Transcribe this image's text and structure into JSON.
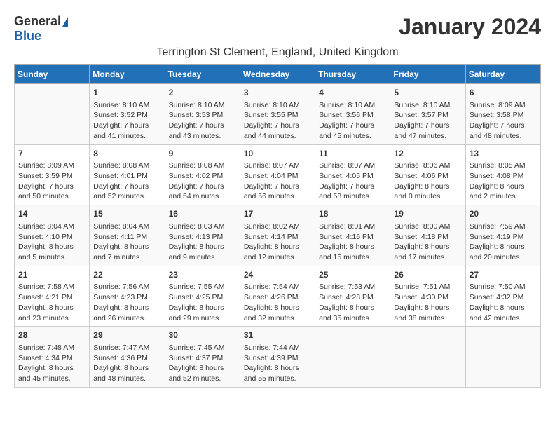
{
  "logo": {
    "general": "General",
    "blue": "Blue"
  },
  "title": "January 2024",
  "location": "Terrington St Clement, England, United Kingdom",
  "headers": [
    "Sunday",
    "Monday",
    "Tuesday",
    "Wednesday",
    "Thursday",
    "Friday",
    "Saturday"
  ],
  "weeks": [
    [
      {
        "day": "",
        "info": ""
      },
      {
        "day": "1",
        "info": "Sunrise: 8:10 AM\nSunset: 3:52 PM\nDaylight: 7 hours and 41 minutes."
      },
      {
        "day": "2",
        "info": "Sunrise: 8:10 AM\nSunset: 3:53 PM\nDaylight: 7 hours and 43 minutes."
      },
      {
        "day": "3",
        "info": "Sunrise: 8:10 AM\nSunset: 3:55 PM\nDaylight: 7 hours and 44 minutes."
      },
      {
        "day": "4",
        "info": "Sunrise: 8:10 AM\nSunset: 3:56 PM\nDaylight: 7 hours and 45 minutes."
      },
      {
        "day": "5",
        "info": "Sunrise: 8:10 AM\nSunset: 3:57 PM\nDaylight: 7 hours and 47 minutes."
      },
      {
        "day": "6",
        "info": "Sunrise: 8:09 AM\nSunset: 3:58 PM\nDaylight: 7 hours and 48 minutes."
      }
    ],
    [
      {
        "day": "7",
        "info": "Sunrise: 8:09 AM\nSunset: 3:59 PM\nDaylight: 7 hours and 50 minutes."
      },
      {
        "day": "8",
        "info": "Sunrise: 8:08 AM\nSunset: 4:01 PM\nDaylight: 7 hours and 52 minutes."
      },
      {
        "day": "9",
        "info": "Sunrise: 8:08 AM\nSunset: 4:02 PM\nDaylight: 7 hours and 54 minutes."
      },
      {
        "day": "10",
        "info": "Sunrise: 8:07 AM\nSunset: 4:04 PM\nDaylight: 7 hours and 56 minutes."
      },
      {
        "day": "11",
        "info": "Sunrise: 8:07 AM\nSunset: 4:05 PM\nDaylight: 7 hours and 58 minutes."
      },
      {
        "day": "12",
        "info": "Sunrise: 8:06 AM\nSunset: 4:06 PM\nDaylight: 8 hours and 0 minutes."
      },
      {
        "day": "13",
        "info": "Sunrise: 8:05 AM\nSunset: 4:08 PM\nDaylight: 8 hours and 2 minutes."
      }
    ],
    [
      {
        "day": "14",
        "info": "Sunrise: 8:04 AM\nSunset: 4:10 PM\nDaylight: 8 hours and 5 minutes."
      },
      {
        "day": "15",
        "info": "Sunrise: 8:04 AM\nSunset: 4:11 PM\nDaylight: 8 hours and 7 minutes."
      },
      {
        "day": "16",
        "info": "Sunrise: 8:03 AM\nSunset: 4:13 PM\nDaylight: 8 hours and 9 minutes."
      },
      {
        "day": "17",
        "info": "Sunrise: 8:02 AM\nSunset: 4:14 PM\nDaylight: 8 hours and 12 minutes."
      },
      {
        "day": "18",
        "info": "Sunrise: 8:01 AM\nSunset: 4:16 PM\nDaylight: 8 hours and 15 minutes."
      },
      {
        "day": "19",
        "info": "Sunrise: 8:00 AM\nSunset: 4:18 PM\nDaylight: 8 hours and 17 minutes."
      },
      {
        "day": "20",
        "info": "Sunrise: 7:59 AM\nSunset: 4:19 PM\nDaylight: 8 hours and 20 minutes."
      }
    ],
    [
      {
        "day": "21",
        "info": "Sunrise: 7:58 AM\nSunset: 4:21 PM\nDaylight: 8 hours and 23 minutes."
      },
      {
        "day": "22",
        "info": "Sunrise: 7:56 AM\nSunset: 4:23 PM\nDaylight: 8 hours and 26 minutes."
      },
      {
        "day": "23",
        "info": "Sunrise: 7:55 AM\nSunset: 4:25 PM\nDaylight: 8 hours and 29 minutes."
      },
      {
        "day": "24",
        "info": "Sunrise: 7:54 AM\nSunset: 4:26 PM\nDaylight: 8 hours and 32 minutes."
      },
      {
        "day": "25",
        "info": "Sunrise: 7:53 AM\nSunset: 4:28 PM\nDaylight: 8 hours and 35 minutes."
      },
      {
        "day": "26",
        "info": "Sunrise: 7:51 AM\nSunset: 4:30 PM\nDaylight: 8 hours and 38 minutes."
      },
      {
        "day": "27",
        "info": "Sunrise: 7:50 AM\nSunset: 4:32 PM\nDaylight: 8 hours and 42 minutes."
      }
    ],
    [
      {
        "day": "28",
        "info": "Sunrise: 7:48 AM\nSunset: 4:34 PM\nDaylight: 8 hours and 45 minutes."
      },
      {
        "day": "29",
        "info": "Sunrise: 7:47 AM\nSunset: 4:36 PM\nDaylight: 8 hours and 48 minutes."
      },
      {
        "day": "30",
        "info": "Sunrise: 7:45 AM\nSunset: 4:37 PM\nDaylight: 8 hours and 52 minutes."
      },
      {
        "day": "31",
        "info": "Sunrise: 7:44 AM\nSunset: 4:39 PM\nDaylight: 8 hours and 55 minutes."
      },
      {
        "day": "",
        "info": ""
      },
      {
        "day": "",
        "info": ""
      },
      {
        "day": "",
        "info": ""
      }
    ]
  ]
}
